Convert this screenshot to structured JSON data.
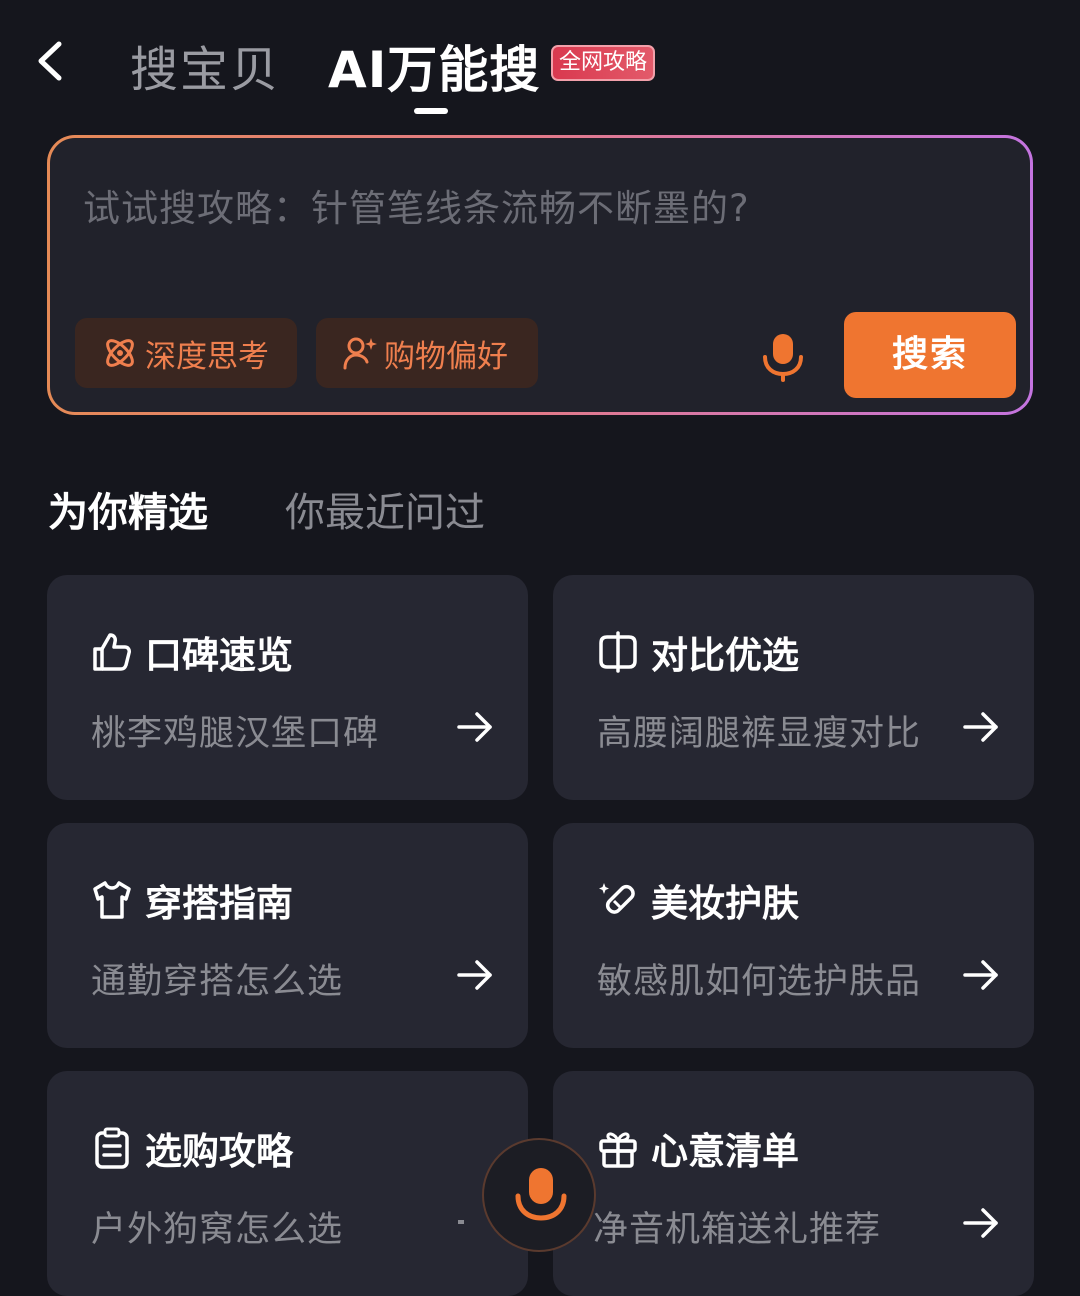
{
  "header": {
    "tabs": [
      {
        "label": "搜宝贝",
        "active": false
      },
      {
        "label": "AI万能搜",
        "active": true
      }
    ],
    "badge": "全网攻略"
  },
  "search": {
    "placeholder": "试试搜攻略：针管笔线条流畅不断墨的?",
    "chips": [
      {
        "label": "深度思考",
        "icon": "atom-icon"
      },
      {
        "label": "购物偏好",
        "icon": "user-sparkle-icon"
      }
    ],
    "button_label": "搜索"
  },
  "sections": {
    "tabs": [
      {
        "label": "为你精选",
        "active": true
      },
      {
        "label": "你最近问过",
        "active": false
      }
    ]
  },
  "cards": [
    {
      "title": "口碑速览",
      "subtitle": "桃李鸡腿汉堡口碑",
      "icon": "thumbs-up-icon"
    },
    {
      "title": "对比优选",
      "subtitle": "高腰阔腿裤显瘦对比",
      "icon": "compare-icon"
    },
    {
      "title": "穿搭指南",
      "subtitle": "通勤穿搭怎么选",
      "icon": "shirt-icon"
    },
    {
      "title": "美妆护肤",
      "subtitle": "敏感肌如何选护肤品",
      "icon": "makeup-icon"
    },
    {
      "title": "选购攻略",
      "subtitle": "户外狗窝怎么选",
      "icon": "clipboard-icon"
    },
    {
      "title": "心意清单",
      "subtitle": "净音机箱送礼推荐",
      "icon": "gift-icon"
    }
  ],
  "colors": {
    "background": "#15161d",
    "accent": "#ef7530",
    "card": "#262732",
    "badge": "#d9394f"
  }
}
